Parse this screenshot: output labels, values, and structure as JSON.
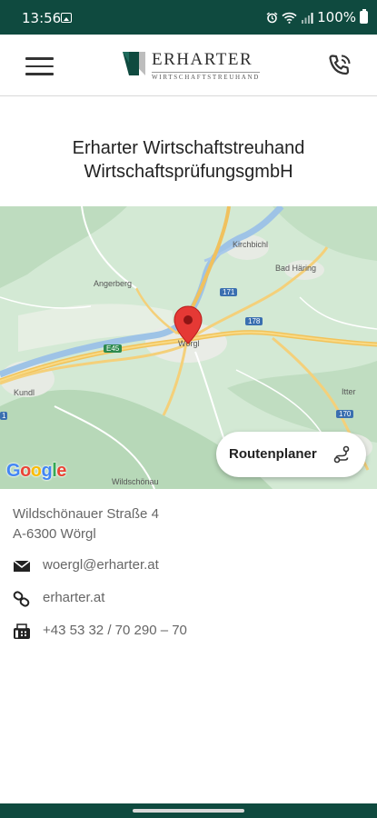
{
  "status_bar": {
    "time": "13:56",
    "battery": "100%",
    "icons": [
      "image-icon",
      "alarm-icon",
      "wifi-icon",
      "signal-icon",
      "battery-icon"
    ]
  },
  "header": {
    "logo_name": "ERHARTER",
    "logo_sub": "WIRTSCHAFTSTREUHAND",
    "menu_icon": "hamburger-menu-icon",
    "phone_icon": "phone-call-icon",
    "brand_color": "#0f4a3f"
  },
  "company": {
    "line1": "Erharter Wirtschaftstreuhand",
    "line2": "WirtschaftsprüfungsgmbH"
  },
  "map": {
    "places": {
      "kirchbichl": "Kirchbichl",
      "bad_haering": "Bad Häring",
      "angerberg": "Angerberg",
      "woergl": "Wörgl",
      "kundl": "Kundl",
      "itter": "Itter",
      "wildschoenau": "Wildschönau"
    },
    "road_labels": {
      "r171": "171",
      "r178": "178",
      "e45": "E45",
      "r170": "170",
      "r1": "1"
    },
    "route_button": "Routenplaner",
    "google": "Google"
  },
  "address": {
    "street": "Wildschönauer Straße 4",
    "city": "A-6300 Wörgl"
  },
  "contacts": {
    "email": "woergl@erharter.at",
    "website": "erharter.at",
    "fax": "+43 53 32 / 70 290 – 70"
  }
}
